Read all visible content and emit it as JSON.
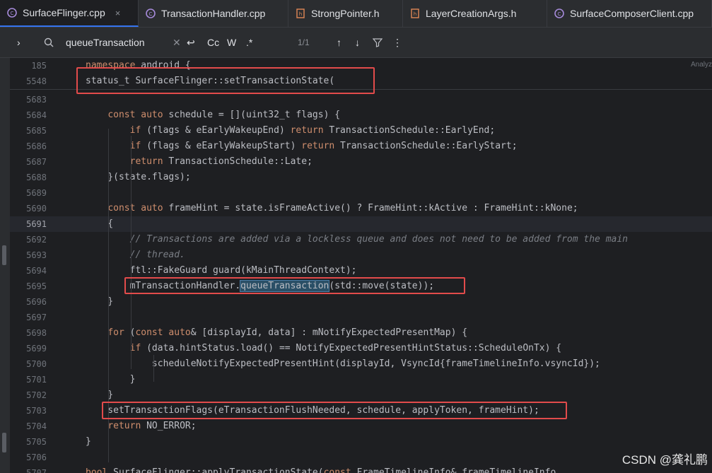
{
  "tabs": [
    {
      "label": "SurfaceFlinger.cpp",
      "active": true,
      "closable": true,
      "icon": "cpp-file-icon"
    },
    {
      "label": "TransactionHandler.cpp",
      "active": false,
      "icon": "cpp-file-icon"
    },
    {
      "label": "StrongPointer.h",
      "active": false,
      "icon": "header-file-icon"
    },
    {
      "label": "LayerCreationArgs.h",
      "active": false,
      "icon": "header-file-icon"
    },
    {
      "label": "SurfaceComposerClient.cpp",
      "active": false,
      "icon": "cpp-file-icon"
    }
  ],
  "search": {
    "query": "queueTransaction",
    "match_case": "Cc",
    "words": "W",
    "regex": ".*",
    "count": "1/1"
  },
  "analyze_label": "Analyz",
  "sticky_lines": [
    {
      "num": "185",
      "code": "namespace android {"
    },
    {
      "num": "5548",
      "code": "status_t SurfaceFlinger::setTransactionState("
    }
  ],
  "lines": [
    {
      "num": "5683",
      "code": ""
    },
    {
      "num": "5684",
      "code": "    const auto schedule = [](uint32_t flags) {"
    },
    {
      "num": "5685",
      "code": "        if (flags & eEarlyWakeupEnd) return TransactionSchedule::EarlyEnd;"
    },
    {
      "num": "5686",
      "code": "        if (flags & eEarlyWakeupStart) return TransactionSchedule::EarlyStart;"
    },
    {
      "num": "5687",
      "code": "        return TransactionSchedule::Late;"
    },
    {
      "num": "5688",
      "code": "    }(state.flags);"
    },
    {
      "num": "5689",
      "code": ""
    },
    {
      "num": "5690",
      "code": "    const auto frameHint = state.isFrameActive() ? FrameHint::kActive : FrameHint::kNone;"
    },
    {
      "num": "5691",
      "code": "    {"
    },
    {
      "num": "5692",
      "code": "        // Transactions are added via a lockless queue and does not need to be added from the main"
    },
    {
      "num": "5693",
      "code": "        // thread."
    },
    {
      "num": "5694",
      "code": "        ftl::FakeGuard guard(kMainThreadContext);"
    },
    {
      "num": "5695",
      "code": "        mTransactionHandler.queueTransaction(std::move(state));"
    },
    {
      "num": "5696",
      "code": "    }"
    },
    {
      "num": "5697",
      "code": ""
    },
    {
      "num": "5698",
      "code": "    for (const auto& [displayId, data] : mNotifyExpectedPresentMap) {"
    },
    {
      "num": "5699",
      "code": "        if (data.hintStatus.load() == NotifyExpectedPresentHintStatus::ScheduleOnTx) {"
    },
    {
      "num": "5700",
      "code": "            scheduleNotifyExpectedPresentHint(displayId, VsyncId{frameTimelineInfo.vsyncId});"
    },
    {
      "num": "5701",
      "code": "        }"
    },
    {
      "num": "5702",
      "code": "    }"
    },
    {
      "num": "5703",
      "code": "    setTransactionFlags(eTransactionFlushNeeded, schedule, applyToken, frameHint);"
    },
    {
      "num": "5704",
      "code": "    return NO_ERROR;"
    },
    {
      "num": "5705",
      "code": "}"
    },
    {
      "num": "5706",
      "code": ""
    },
    {
      "num": "5707",
      "code": "bool SurfaceFlinger::applyTransactionState(const FrameTimelineInfo& frameTimelineInfo,"
    }
  ],
  "current_line": "5691",
  "watermark": "CSDN @龚礼鹏",
  "colors": {
    "annotation": "#e24b4b",
    "background": "#1e1f22",
    "keyword": "#cf8e6d"
  }
}
